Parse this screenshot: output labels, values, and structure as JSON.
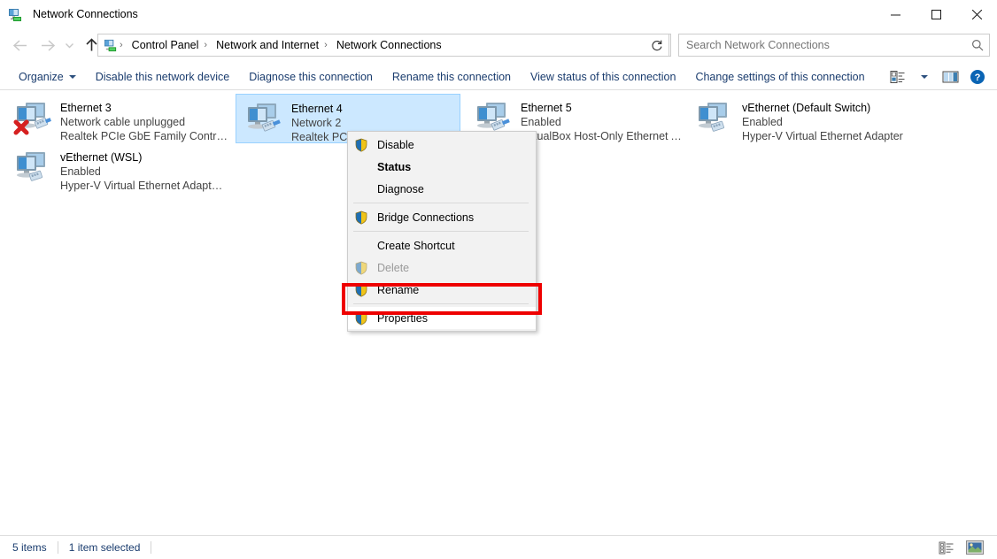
{
  "window": {
    "title": "Network Connections",
    "icon": "network-connections-icon",
    "controls": {
      "minimize": "─",
      "maximize": "□",
      "close": "✕"
    }
  },
  "address_bar": {
    "back_icon": "arrow-left-icon",
    "forward_icon": "arrow-right-icon",
    "recent_icon": "chevron-down-icon",
    "up_icon": "arrow-up-icon",
    "breadcrumb": [
      "Control Panel",
      "Network and Internet",
      "Network Connections"
    ],
    "separator": "›",
    "dropdown_icon": "chevron-down-icon",
    "refresh_icon": "refresh-icon",
    "search": {
      "placeholder": "Search Network Connections",
      "value": "",
      "icon": "search-icon"
    }
  },
  "toolbar": {
    "organize": "Organize",
    "items": [
      "Disable this network device",
      "Diagnose this connection",
      "Rename this connection",
      "View status of this connection",
      "Change settings of this connection"
    ],
    "change_view_icon": "change-view-icon",
    "change_view_caret": "chevron-down-icon",
    "preview_pane_icon": "preview-pane-icon",
    "help_icon": "help-icon",
    "help_glyph": "?"
  },
  "connections": [
    {
      "name": "Ethernet 3",
      "status": "Network cable unplugged",
      "device": "Realtek PCIe GbE Family Controll...",
      "selected": false,
      "disconnected": true,
      "icon": "network-adapter-icon"
    },
    {
      "name": "Ethernet 4",
      "status": "Network 2",
      "device": "Realtek PCIe GbE Family Controll...",
      "selected": true,
      "disconnected": false,
      "icon": "network-adapter-icon"
    },
    {
      "name": "Ethernet 5",
      "status": "Enabled",
      "device": "VirtualBox Host-Only Ethernet Ad...",
      "selected": false,
      "disconnected": false,
      "icon": "network-adapter-icon"
    },
    {
      "name": "vEthernet (Default Switch)",
      "status": "Enabled",
      "device": "Hyper-V Virtual Ethernet Adapter",
      "selected": false,
      "disconnected": false,
      "icon": "network-adapter-icon"
    },
    {
      "name": "vEthernet (WSL)",
      "status": "Enabled",
      "device": "Hyper-V Virtual Ethernet Adapter ...",
      "selected": false,
      "disconnected": false,
      "icon": "network-adapter-icon"
    }
  ],
  "context_menu": {
    "items": [
      {
        "label": "Disable",
        "shield": true,
        "bold": false,
        "disabled": false,
        "separator_after": false
      },
      {
        "label": "Status",
        "shield": false,
        "bold": true,
        "disabled": false,
        "separator_after": false
      },
      {
        "label": "Diagnose",
        "shield": false,
        "bold": false,
        "disabled": false,
        "separator_after": true
      },
      {
        "label": "Bridge Connections",
        "shield": true,
        "bold": false,
        "disabled": false,
        "separator_after": true
      },
      {
        "label": "Create Shortcut",
        "shield": false,
        "bold": false,
        "disabled": false,
        "separator_after": false
      },
      {
        "label": "Delete",
        "shield": true,
        "bold": false,
        "disabled": true,
        "separator_after": false
      },
      {
        "label": "Rename",
        "shield": true,
        "bold": false,
        "disabled": false,
        "separator_after": true
      },
      {
        "label": "Properties",
        "shield": true,
        "bold": false,
        "disabled": false,
        "separator_after": false
      }
    ]
  },
  "status_bar": {
    "item_count": "5 items",
    "selection": "1 item selected",
    "details_view_icon": "details-view-icon",
    "large_icons_view_icon": "large-icons-view-icon"
  },
  "colors": {
    "selection_fill": "#cce8ff",
    "selection_border": "#99d1ff",
    "link_text": "#1a3c6e",
    "annotation_red": "#ee0000",
    "menu_bg": "#f2f2f2",
    "help_blue": "#0a64b4"
  }
}
